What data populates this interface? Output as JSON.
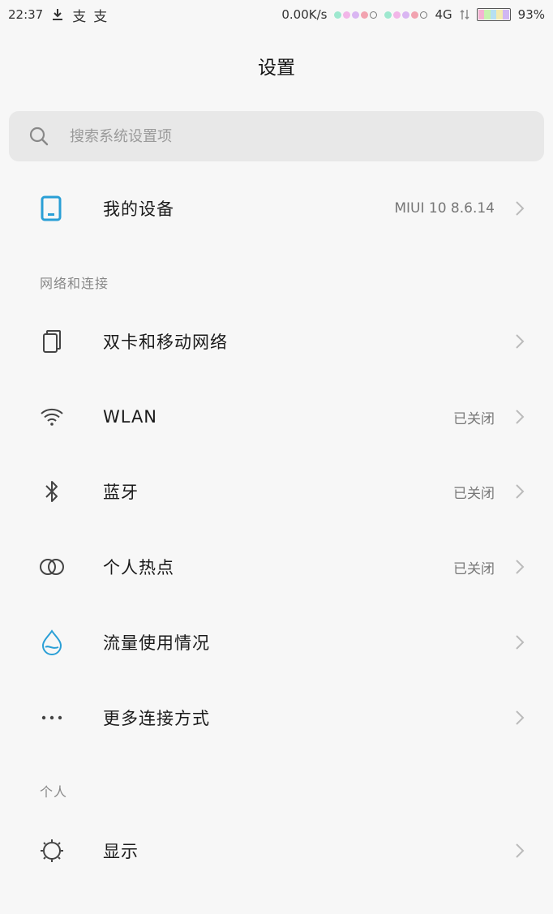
{
  "status_bar": {
    "time": "22:37",
    "net_speed": "0.00K/s",
    "network": "4G",
    "battery": "93%"
  },
  "title": "设置",
  "search": {
    "placeholder": "搜索系统设置项"
  },
  "my_device": {
    "label": "我的设备",
    "value": "MIUI 10 8.6.14"
  },
  "sections": {
    "network_header": "网络和连接",
    "personal_header": "个人"
  },
  "network_items": [
    {
      "label": "双卡和移动网络",
      "value": "",
      "icon": "dual-sim-icon"
    },
    {
      "label": "WLAN",
      "value": "已关闭",
      "icon": "wifi-icon"
    },
    {
      "label": "蓝牙",
      "value": "已关闭",
      "icon": "bluetooth-icon"
    },
    {
      "label": "个人热点",
      "value": "已关闭",
      "icon": "hotspot-icon"
    },
    {
      "label": "流量使用情况",
      "value": "",
      "icon": "water-drop-icon"
    },
    {
      "label": "更多连接方式",
      "value": "",
      "icon": "more-dots-icon"
    }
  ],
  "personal_items": [
    {
      "label": "显示",
      "value": "",
      "icon": "brightness-icon"
    }
  ],
  "colors": {
    "accent": "#2a9fd6",
    "background": "#f7f7f7",
    "search_bg": "#e8e8e8"
  }
}
